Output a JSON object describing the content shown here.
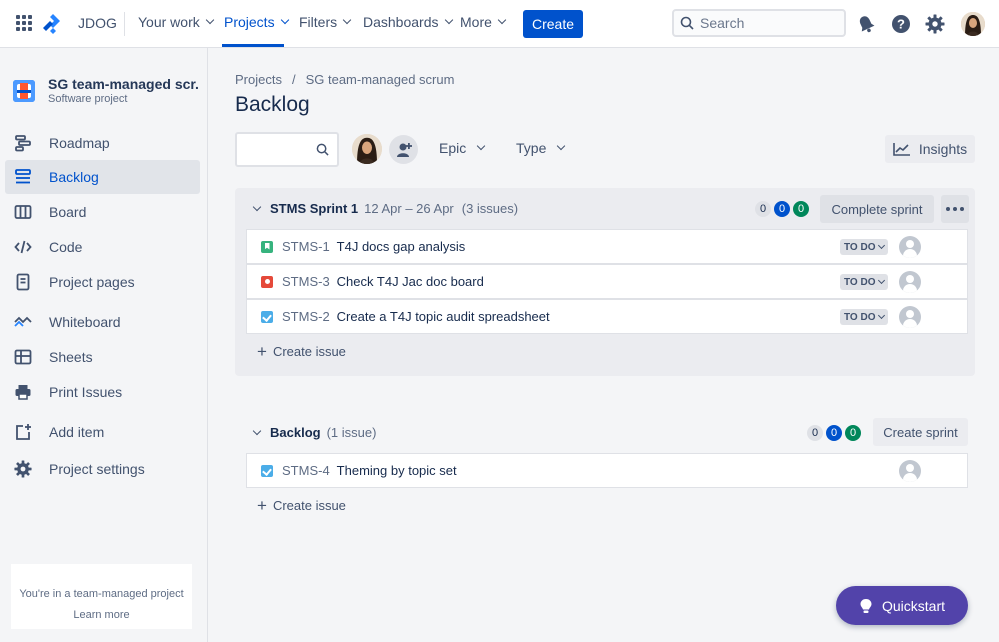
{
  "topnav": {
    "site_name": "JDOG",
    "items": [
      {
        "label": "Your work"
      },
      {
        "label": "Projects"
      },
      {
        "label": "Filters"
      },
      {
        "label": "Dashboards"
      },
      {
        "label": "More"
      }
    ],
    "create_label": "Create",
    "search_placeholder": "Search"
  },
  "sidebar": {
    "project_name": "SG team-managed scr...",
    "project_type": "Software project",
    "items": [
      {
        "label": "Roadmap"
      },
      {
        "label": "Backlog"
      },
      {
        "label": "Board"
      },
      {
        "label": "Code"
      },
      {
        "label": "Project pages"
      },
      {
        "label": "Whiteboard"
      },
      {
        "label": "Sheets"
      },
      {
        "label": "Print Issues"
      },
      {
        "label": "Add item"
      },
      {
        "label": "Project settings"
      }
    ],
    "team_notice": "You're in a team-managed project",
    "learn_more": "Learn more"
  },
  "breadcrumb": {
    "root": "Projects",
    "separator": "/",
    "project": "SG team-managed scrum"
  },
  "page_title": "Backlog",
  "filters": {
    "epic": "Epic",
    "type": "Type",
    "insights": "Insights"
  },
  "sprint": {
    "name": "STMS Sprint 1",
    "dates": "12 Apr – 26 Apr",
    "issue_count": "(3 issues)",
    "counts": [
      "0",
      "0",
      "0"
    ],
    "complete_label": "Complete sprint",
    "issues": [
      {
        "key": "STMS-1",
        "summary": "T4J docs gap analysis",
        "type": "story",
        "status": "TO DO"
      },
      {
        "key": "STMS-3",
        "summary": "Check T4J Jac doc board",
        "type": "bug",
        "status": "TO DO"
      },
      {
        "key": "STMS-2",
        "summary": "Create a T4J topic audit spreadsheet",
        "type": "task",
        "status": "TO DO"
      }
    ],
    "create_issue": "Create issue"
  },
  "backlog": {
    "name": "Backlog",
    "issue_count": "(1 issue)",
    "counts": [
      "0",
      "0",
      "0"
    ],
    "create_sprint": "Create sprint",
    "issues": [
      {
        "key": "STMS-4",
        "summary": "Theming by topic set",
        "type": "task"
      }
    ],
    "create_issue": "Create issue"
  },
  "quickstart_label": "Quickstart",
  "colors": {
    "accent": "#0052cc",
    "quickstart": "#5243aa",
    "done": "#00875a"
  }
}
